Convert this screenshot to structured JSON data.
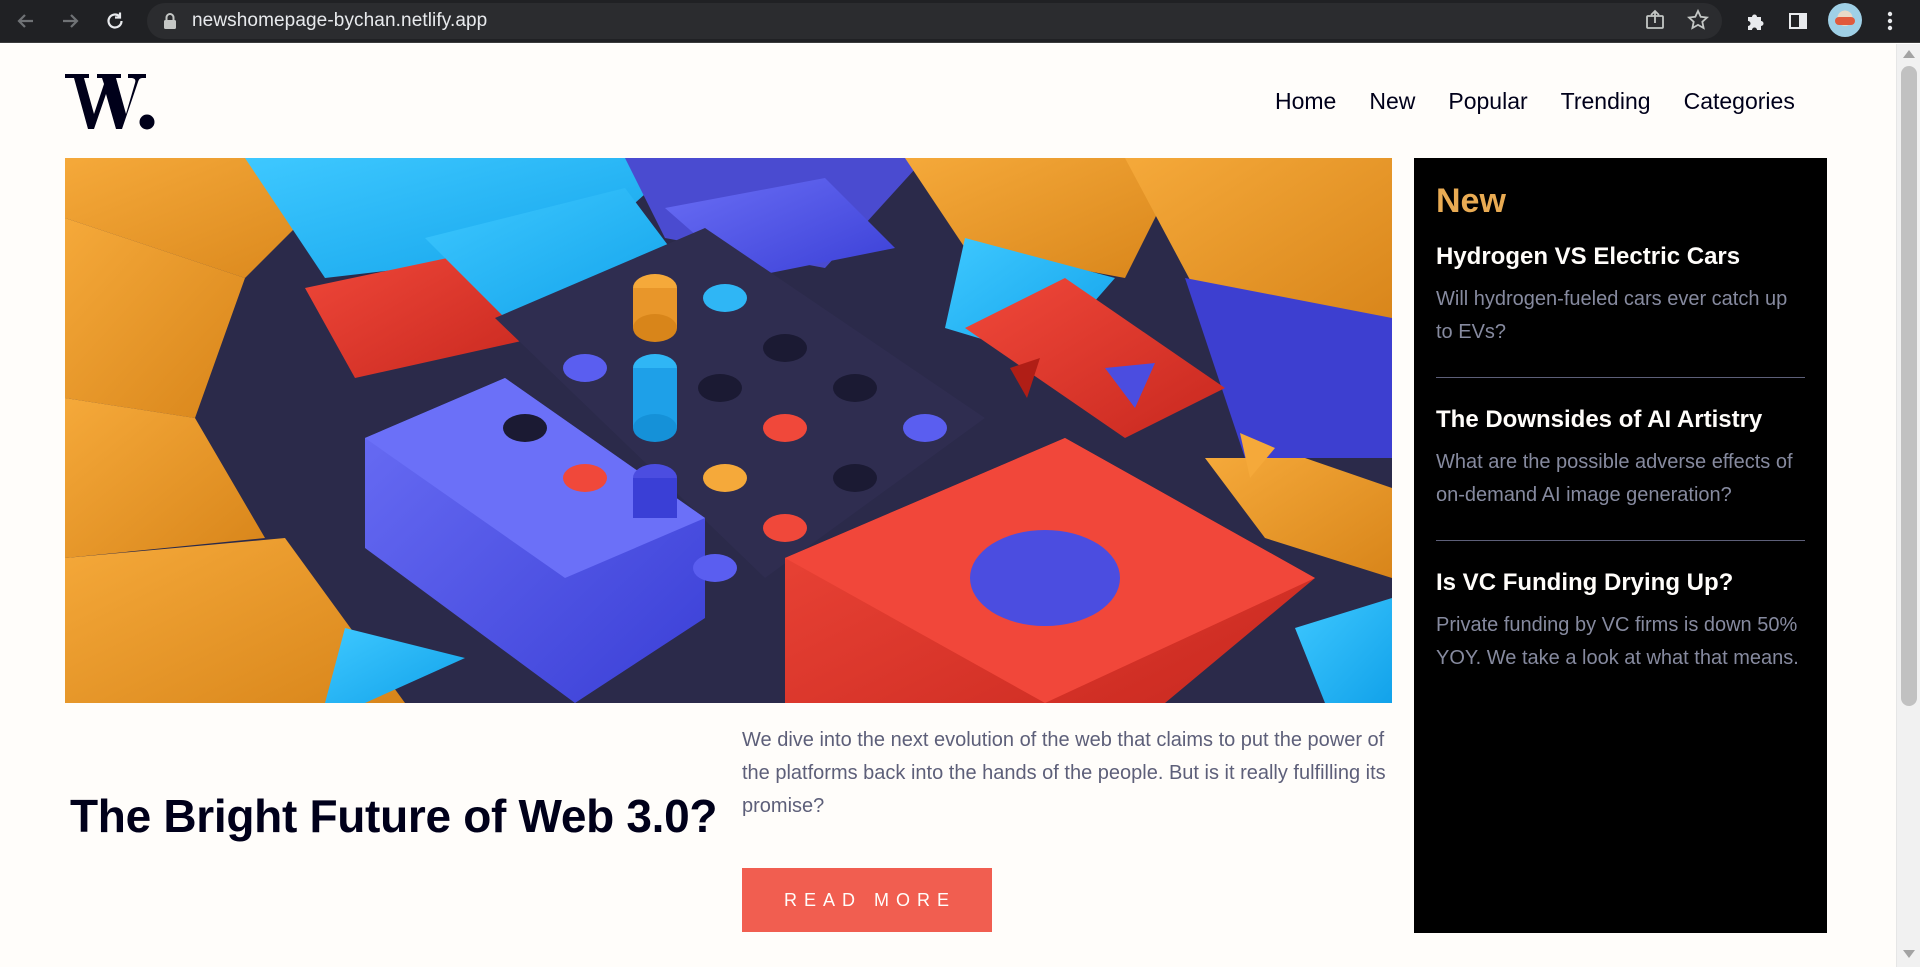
{
  "browser": {
    "url": "newshomepage-bychan.netlify.app"
  },
  "site": {
    "logo_text": "W.",
    "nav": [
      "Home",
      "New",
      "Popular",
      "Trending",
      "Categories"
    ]
  },
  "hero": {
    "headline": "The Bright Future of Web 3.0?",
    "lede": "We dive into the next evolution of the web that claims to put the power of the platforms back into the hands of the people. But is it really fulfilling its promise?",
    "cta": "READ MORE"
  },
  "sidebar": {
    "title": "New",
    "items": [
      {
        "title": "Hydrogen VS Electric Cars",
        "desc": "Will hydrogen-fueled cars ever catch up to EVs?"
      },
      {
        "title": "The Downsides of AI Artistry",
        "desc": "What are the possible adverse effects of on-demand AI image generation?"
      },
      {
        "title": "Is VC Funding Drying Up?",
        "desc": "Private funding by VC firms is down 50% YOY. We take a look at what that means."
      }
    ]
  },
  "colors": {
    "accent_red": "#f15e50",
    "accent_orange": "#e9ab53",
    "dark": "#00001a",
    "grey_blue": "#5d5f79"
  }
}
